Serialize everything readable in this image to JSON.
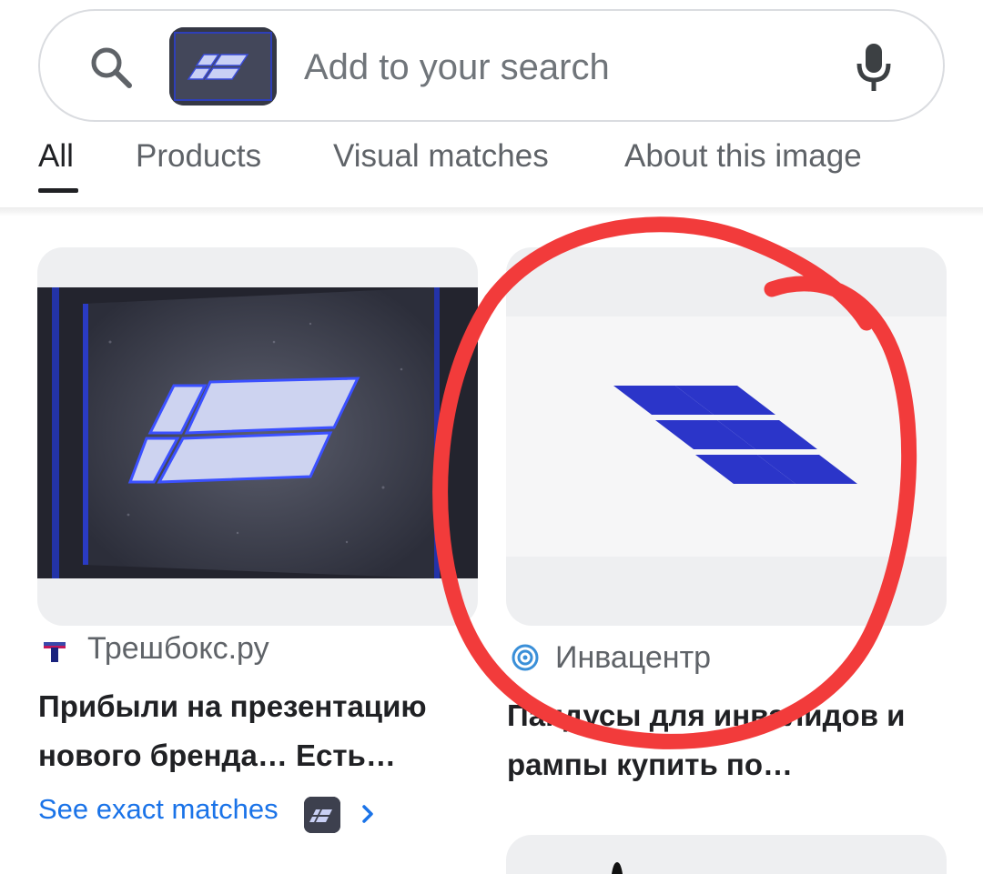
{
  "search": {
    "placeholder": "Add to your search"
  },
  "tabs": [
    {
      "label": "All",
      "active": true
    },
    {
      "label": "Products",
      "active": false
    },
    {
      "label": "Visual matches",
      "active": false
    },
    {
      "label": "About this image",
      "active": false
    }
  ],
  "results": [
    {
      "source": "Трешбокс.ру",
      "title_line1": "Прибыли на презентацию",
      "title_line2": "нового бренда… Есть…"
    },
    {
      "source": "Инвацентр",
      "title_line1": "Пандусы для инвалидов и",
      "title_line2": "рампы купить по…"
    }
  ],
  "see_exact_matches": "See exact matches",
  "colors": {
    "accent_blue": "#1a73e8",
    "logo_blue": "#2b35c9",
    "annotation_red": "#f23b3b"
  },
  "icons": [
    "search-icon",
    "mic-icon",
    "chevron-right-icon",
    "treshbox-favicon",
    "invacenter-favicon"
  ]
}
